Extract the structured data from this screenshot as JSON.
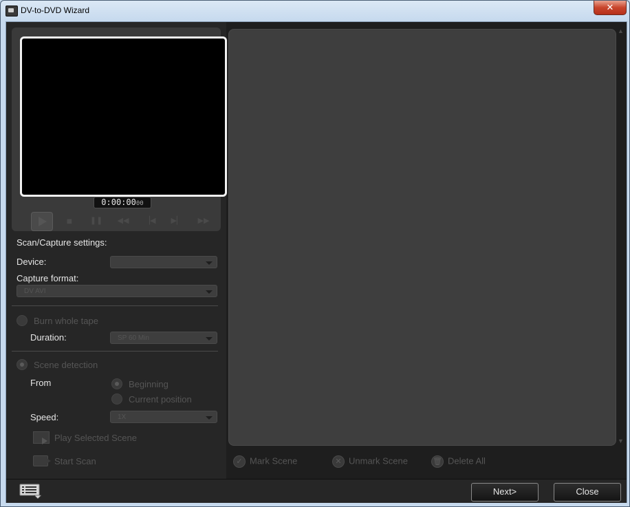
{
  "window": {
    "title": "DV-to-DVD Wizard",
    "close_glyph": "✕"
  },
  "preview": {
    "timecode_main": "0:00:00",
    "timecode_frames": "00"
  },
  "controls": {
    "stop": "■",
    "pause": "❚❚",
    "rewind": "◀◀",
    "prev": "▕◀",
    "next": "▶▏",
    "fastforward": "▶▶"
  },
  "settings": {
    "section_label": "Scan/Capture settings:",
    "device_label": "Device:",
    "device_value": "",
    "capture_format_label": "Capture format:",
    "capture_format_value": "DV AVI",
    "burn_whole_tape_label": "Burn whole tape",
    "duration_label": "Duration:",
    "duration_value": "SP 60 Min",
    "scene_detection_label": "Scene detection",
    "from_label": "From",
    "beginning_label": "Beginning",
    "current_position_label": "Current position",
    "speed_label": "Speed:",
    "speed_value": "1X",
    "play_selected_scene_label": "Play Selected Scene",
    "start_scan_label": "Start Scan"
  },
  "scene_actions": {
    "mark_scene": "Mark Scene",
    "unmark_scene": "Unmark Scene",
    "delete_all": "Delete All",
    "mark_glyph": "✓",
    "unmark_glyph": "✕",
    "delete_glyph": "🗑"
  },
  "footer": {
    "next_label": "Next>",
    "close_label": "Close"
  },
  "icons": {
    "app": "camcorder-app-icon",
    "options": "options-list-icon",
    "play_scene": "film-play-icon",
    "scan": "camcorder-icon"
  }
}
